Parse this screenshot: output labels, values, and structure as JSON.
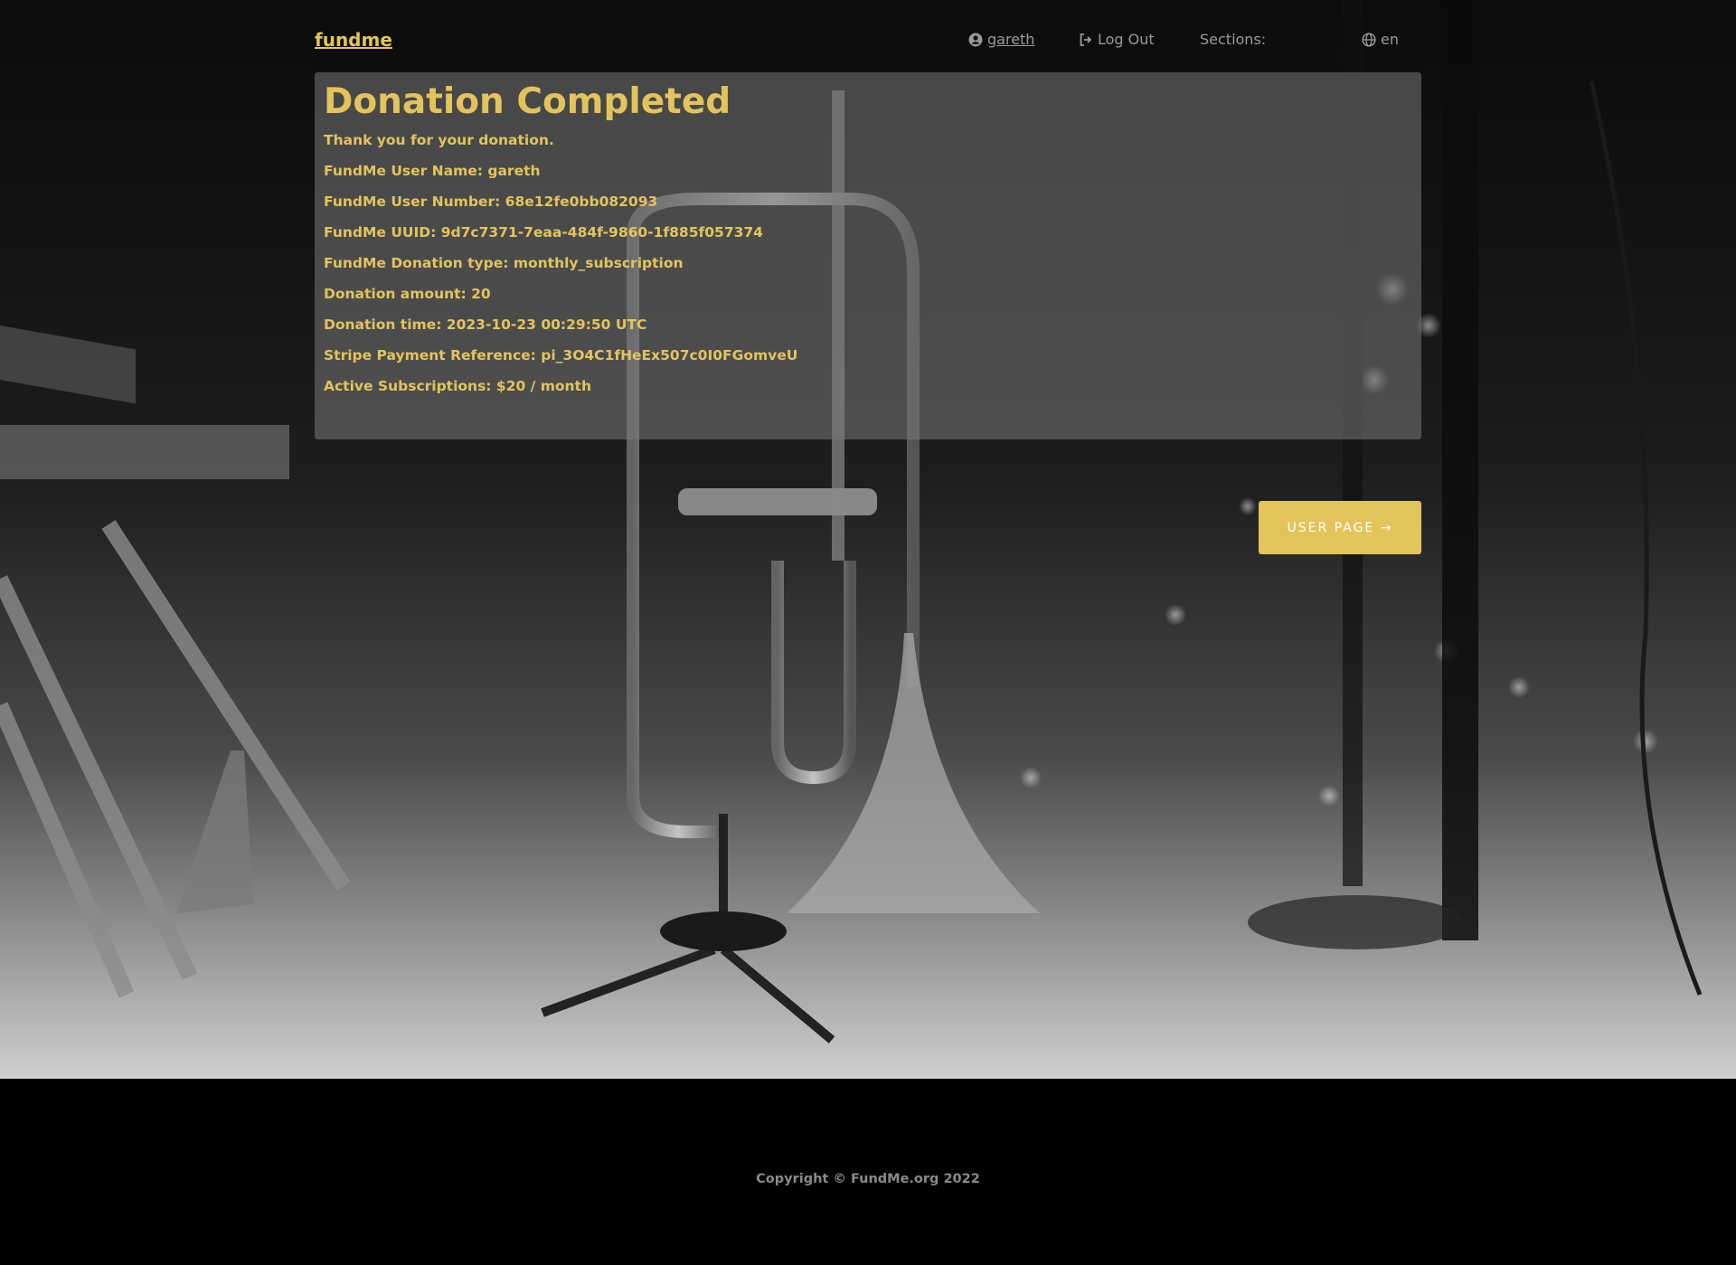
{
  "nav": {
    "brand": "fundme",
    "user": "gareth",
    "logout": "Log Out",
    "sections": "Sections:",
    "lang": "en"
  },
  "panel": {
    "title": "Donation Completed",
    "lines": [
      "Thank you for your donation.",
      "FundMe User Name: gareth",
      "FundMe User Number: 68e12fe0bb082093",
      "FundMe UUID: 9d7c7371-7eaa-484f-9860-1f885f057374",
      "FundMe Donation type: monthly_subscription",
      "Donation amount: 20",
      "Donation time: 2023-10-23 00:29:50 UTC",
      "Stripe Payment Reference: pi_3O4C1fHeEx507c0I0FGomveU",
      "Active Subscriptions: $20 / month"
    ]
  },
  "button": {
    "user_page": "USER PAGE →"
  },
  "footer": {
    "copyright": "Copyright © FundMe.org 2022"
  },
  "colors": {
    "accent": "#e3c45c",
    "muted": "#9a9a9a",
    "footer_bg": "#000000"
  },
  "icons": {
    "user": "user-circle-icon",
    "logout": "logout-icon",
    "lang": "globe-icon"
  }
}
